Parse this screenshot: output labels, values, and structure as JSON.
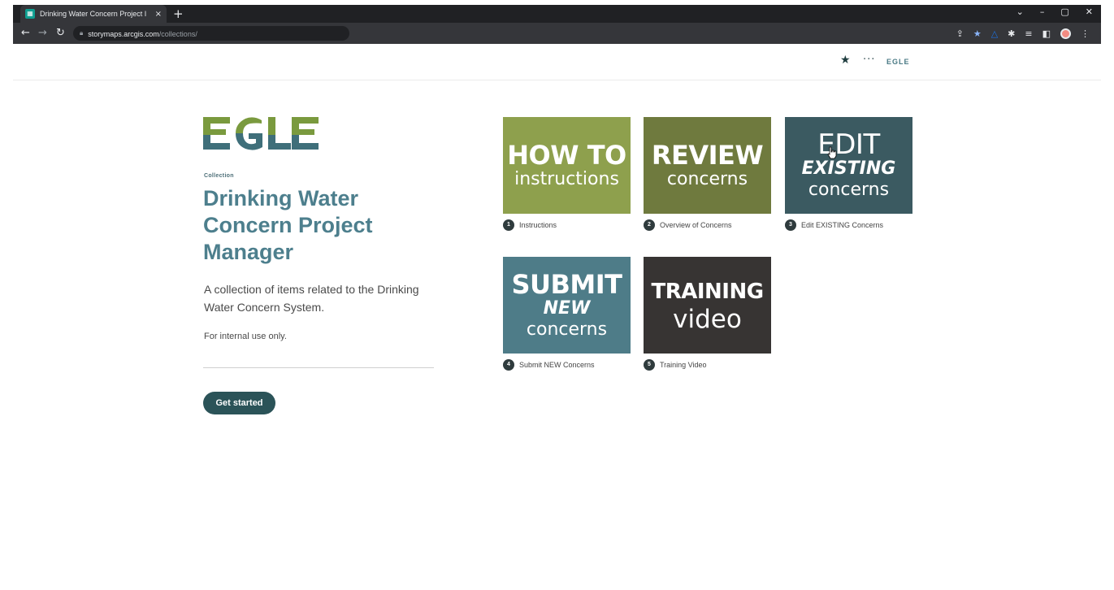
{
  "browser": {
    "tab_title": "Drinking Water Concern Project I",
    "tab_close": "×",
    "new_tab": "+",
    "url_host": "storymaps.arcgis.com",
    "url_path": "/collections/",
    "win_controls": [
      "⌄",
      "–",
      "▢",
      "✕"
    ]
  },
  "header": {
    "logo_text": "EGLE",
    "more": "···"
  },
  "collection": {
    "brand": "EGLE",
    "brand_colors": {
      "top": "#7a9a3e",
      "bottom": "#3f6f7a"
    },
    "label": "Collection",
    "title": "Drinking Water Concern Project Manager",
    "description": "A collection of items related to the Drinking Water Concern System.",
    "note": "For internal use only.",
    "cta": "Get started"
  },
  "items": [
    {
      "number": "1",
      "caption": "Instructions",
      "thumb_line1": "HOW TO",
      "thumb_line2": "instructions",
      "thumb_line3": "",
      "color": "#8ea04d"
    },
    {
      "number": "2",
      "caption": "Overview of Concerns",
      "thumb_line1": "REVIEW",
      "thumb_line2": "concerns",
      "thumb_line3": "",
      "color": "#6f7a3e"
    },
    {
      "number": "3",
      "caption": "Edit EXISTING Concerns",
      "thumb_line1": "EDIT",
      "thumb_line2": "EXISTING",
      "thumb_line3": "concerns",
      "color": "#3b5a61"
    },
    {
      "number": "4",
      "caption": "Submit NEW Concerns",
      "thumb_line1": "SUBMIT",
      "thumb_line2": "NEW",
      "thumb_line3": "concerns",
      "color": "#4e7c88"
    },
    {
      "number": "5",
      "caption": "Training Video",
      "thumb_line1": "TRAINING",
      "thumb_line2": "video",
      "thumb_line3": "",
      "color": "#373433"
    }
  ]
}
